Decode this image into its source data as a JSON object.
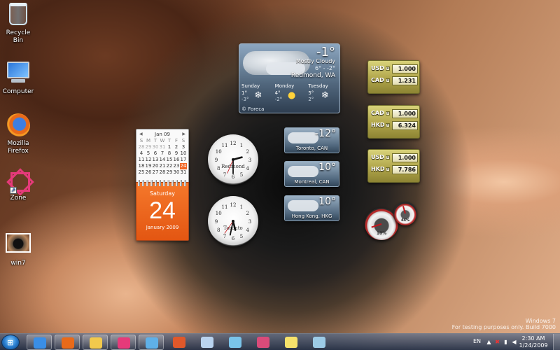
{
  "desktop_icons": [
    {
      "label": "Recycle Bin",
      "icon": "recycle-bin-icon"
    },
    {
      "label": "Computer",
      "icon": "computer-icon"
    },
    {
      "label": "Mozilla Firefox",
      "icon": "firefox-icon"
    },
    {
      "label": "Zone",
      "icon": "zone-icon"
    },
    {
      "label": "win7",
      "icon": "image-thumbnail-icon"
    }
  ],
  "weather_main": {
    "temp": "-1°",
    "condition": "Mostly Cloudy",
    "range": "6° - -2°",
    "location": "Redmond, WA",
    "credit": "© Foreca",
    "forecast": [
      {
        "day": "Sunday",
        "hi": "1°",
        "lo": "-3°",
        "icon": "snow-icon"
      },
      {
        "day": "Monday",
        "hi": "4°",
        "lo": "-2°",
        "icon": "sun-icon"
      },
      {
        "day": "Tuesday",
        "hi": "5°",
        "lo": "2°",
        "icon": "snow-icon"
      }
    ]
  },
  "mini_weather": [
    {
      "temp": "-12°",
      "city": "Toronto, CAN"
    },
    {
      "temp": "10°",
      "city": "Montreal, CAN"
    },
    {
      "temp": "10°",
      "city": "Hong Kong, HKG"
    }
  ],
  "calendar": {
    "month_header": "Jan 09",
    "weekdays": [
      "S",
      "M",
      "T",
      "W",
      "T",
      "F",
      "S"
    ],
    "days": [
      "28",
      "29",
      "30",
      "31",
      "1",
      "2",
      "3",
      "4",
      "5",
      "6",
      "7",
      "8",
      "9",
      "10",
      "11",
      "12",
      "13",
      "14",
      "15",
      "16",
      "17",
      "18",
      "19",
      "20",
      "21",
      "22",
      "23",
      "24",
      "25",
      "26",
      "27",
      "28",
      "29",
      "30",
      "31"
    ],
    "today_index": 27,
    "day_name": "Saturday",
    "day_number": "24",
    "month_year": "January 2009"
  },
  "clocks": [
    {
      "city": "Redmond",
      "hour": 2,
      "minute": 30
    },
    {
      "city": "Toronto",
      "hour": 5,
      "minute": 32
    }
  ],
  "currencies": [
    {
      "rows": [
        {
          "code": "USD",
          "value": "1.000"
        },
        {
          "code": "CAD",
          "value": "1.231"
        }
      ]
    },
    {
      "rows": [
        {
          "code": "CAD",
          "value": "1.000"
        },
        {
          "code": "HKD",
          "value": "6.324"
        }
      ]
    },
    {
      "rows": [
        {
          "code": "USD",
          "value": "1.000"
        },
        {
          "code": "HKD",
          "value": "7.786"
        }
      ]
    }
  ],
  "cpu_meter": {
    "cpu_label": "10%",
    "cpu_level": 0.1,
    "mem_label": "44%",
    "mem_level": 0.44
  },
  "watermark": {
    "line1": "Windows 7",
    "line2": "For testing purposes only. Build 7000"
  },
  "taskbar": {
    "apps": [
      {
        "icon": "internet-explorer-icon",
        "color": "#3a8ee6"
      },
      {
        "icon": "firefox-icon",
        "color": "#e86a1a"
      },
      {
        "icon": "windows-explorer-icon",
        "color": "#f2c94c"
      },
      {
        "icon": "zone-icon",
        "color": "#e63a7a"
      },
      {
        "icon": "control-panel-icon",
        "color": "#5fb0e8"
      },
      {
        "icon": "media-player-icon",
        "color": "#e0582a"
      },
      {
        "icon": "notepad-icon",
        "color": "#b9d3ef"
      },
      {
        "icon": "paint-icon",
        "color": "#7ac4ea"
      },
      {
        "icon": "ribbon-app-icon",
        "color": "#d94b7a"
      },
      {
        "icon": "sticky-notes-icon",
        "color": "#f6e26b"
      },
      {
        "icon": "folder-icon",
        "color": "#9ccbe6"
      }
    ],
    "language": "EN",
    "time": "2:30 AM",
    "date": "1/24/2009"
  }
}
